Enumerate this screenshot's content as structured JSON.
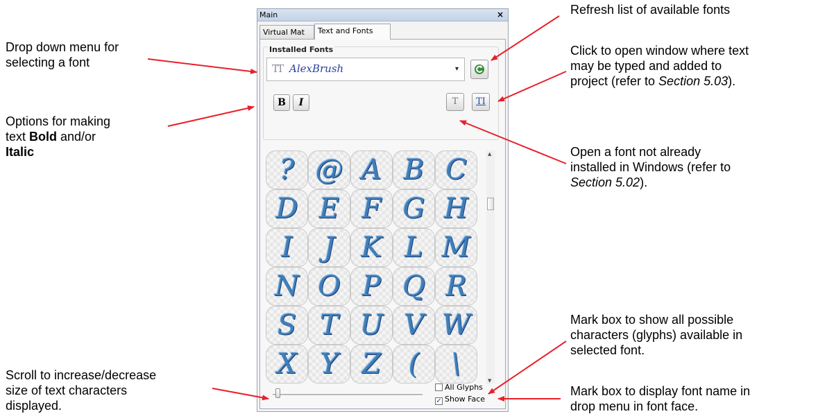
{
  "panel": {
    "title": "Main",
    "close": "×",
    "tabs": [
      "Virtual Mat",
      "Text and Fonts"
    ],
    "group_label": "Installed Fonts",
    "tt_icon": "TT",
    "font_name": "AlexBrush",
    "dropdown_arrow": "▾",
    "refresh_icon": "C",
    "bold_label": "B",
    "italic_label": "I",
    "open_font_icon": "T",
    "text_window_icon": "TI",
    "glyphs": [
      "?",
      "@",
      "A",
      "B",
      "C",
      "D",
      "E",
      "F",
      "G",
      "H",
      "I",
      "J",
      "K",
      "L",
      "M",
      "N",
      "O",
      "P",
      "Q",
      "R",
      "S",
      "T",
      "U",
      "V",
      "W",
      "X",
      "Y",
      "Z",
      "(",
      "\\"
    ],
    "size_slider_value": 0.02,
    "all_glyphs": {
      "label": "All Glyphs",
      "checked": false
    },
    "show_face": {
      "label": "Show Face",
      "checked": true
    }
  },
  "annotations": {
    "dropdown": [
      "Drop down menu for",
      "selecting a font"
    ],
    "bold_italic": {
      "line1": "Options for making",
      "prefix2": "text ",
      "bold": "Bold",
      "suffix2": " and/or",
      "italic": "Italic"
    },
    "scroll_size": [
      "Scroll to increase/decrease",
      "size of text characters",
      "displayed."
    ],
    "refresh": "Refresh list of available fonts",
    "text_window": {
      "line1": "Click to open window where text",
      "line2": "may be typed and added to",
      "prefix3": "project (refer to ",
      "ref": "Section 5.03",
      "suffix3": ")."
    },
    "open_font": {
      "line1": "Open a font not already",
      "line2": "installed in Windows (refer to",
      "ref": "Section 5.02",
      "suffix3": ")."
    },
    "all_glyphs": [
      "Mark box to show all possible",
      "characters (glyphs) available in",
      "selected font."
    ],
    "show_face": [
      "Mark box to display font name in",
      "drop menu in font face."
    ]
  },
  "colors": {
    "arrow": "#e8202a",
    "glyph": "#3f7fb9",
    "font_name": "#2c3f9e"
  }
}
